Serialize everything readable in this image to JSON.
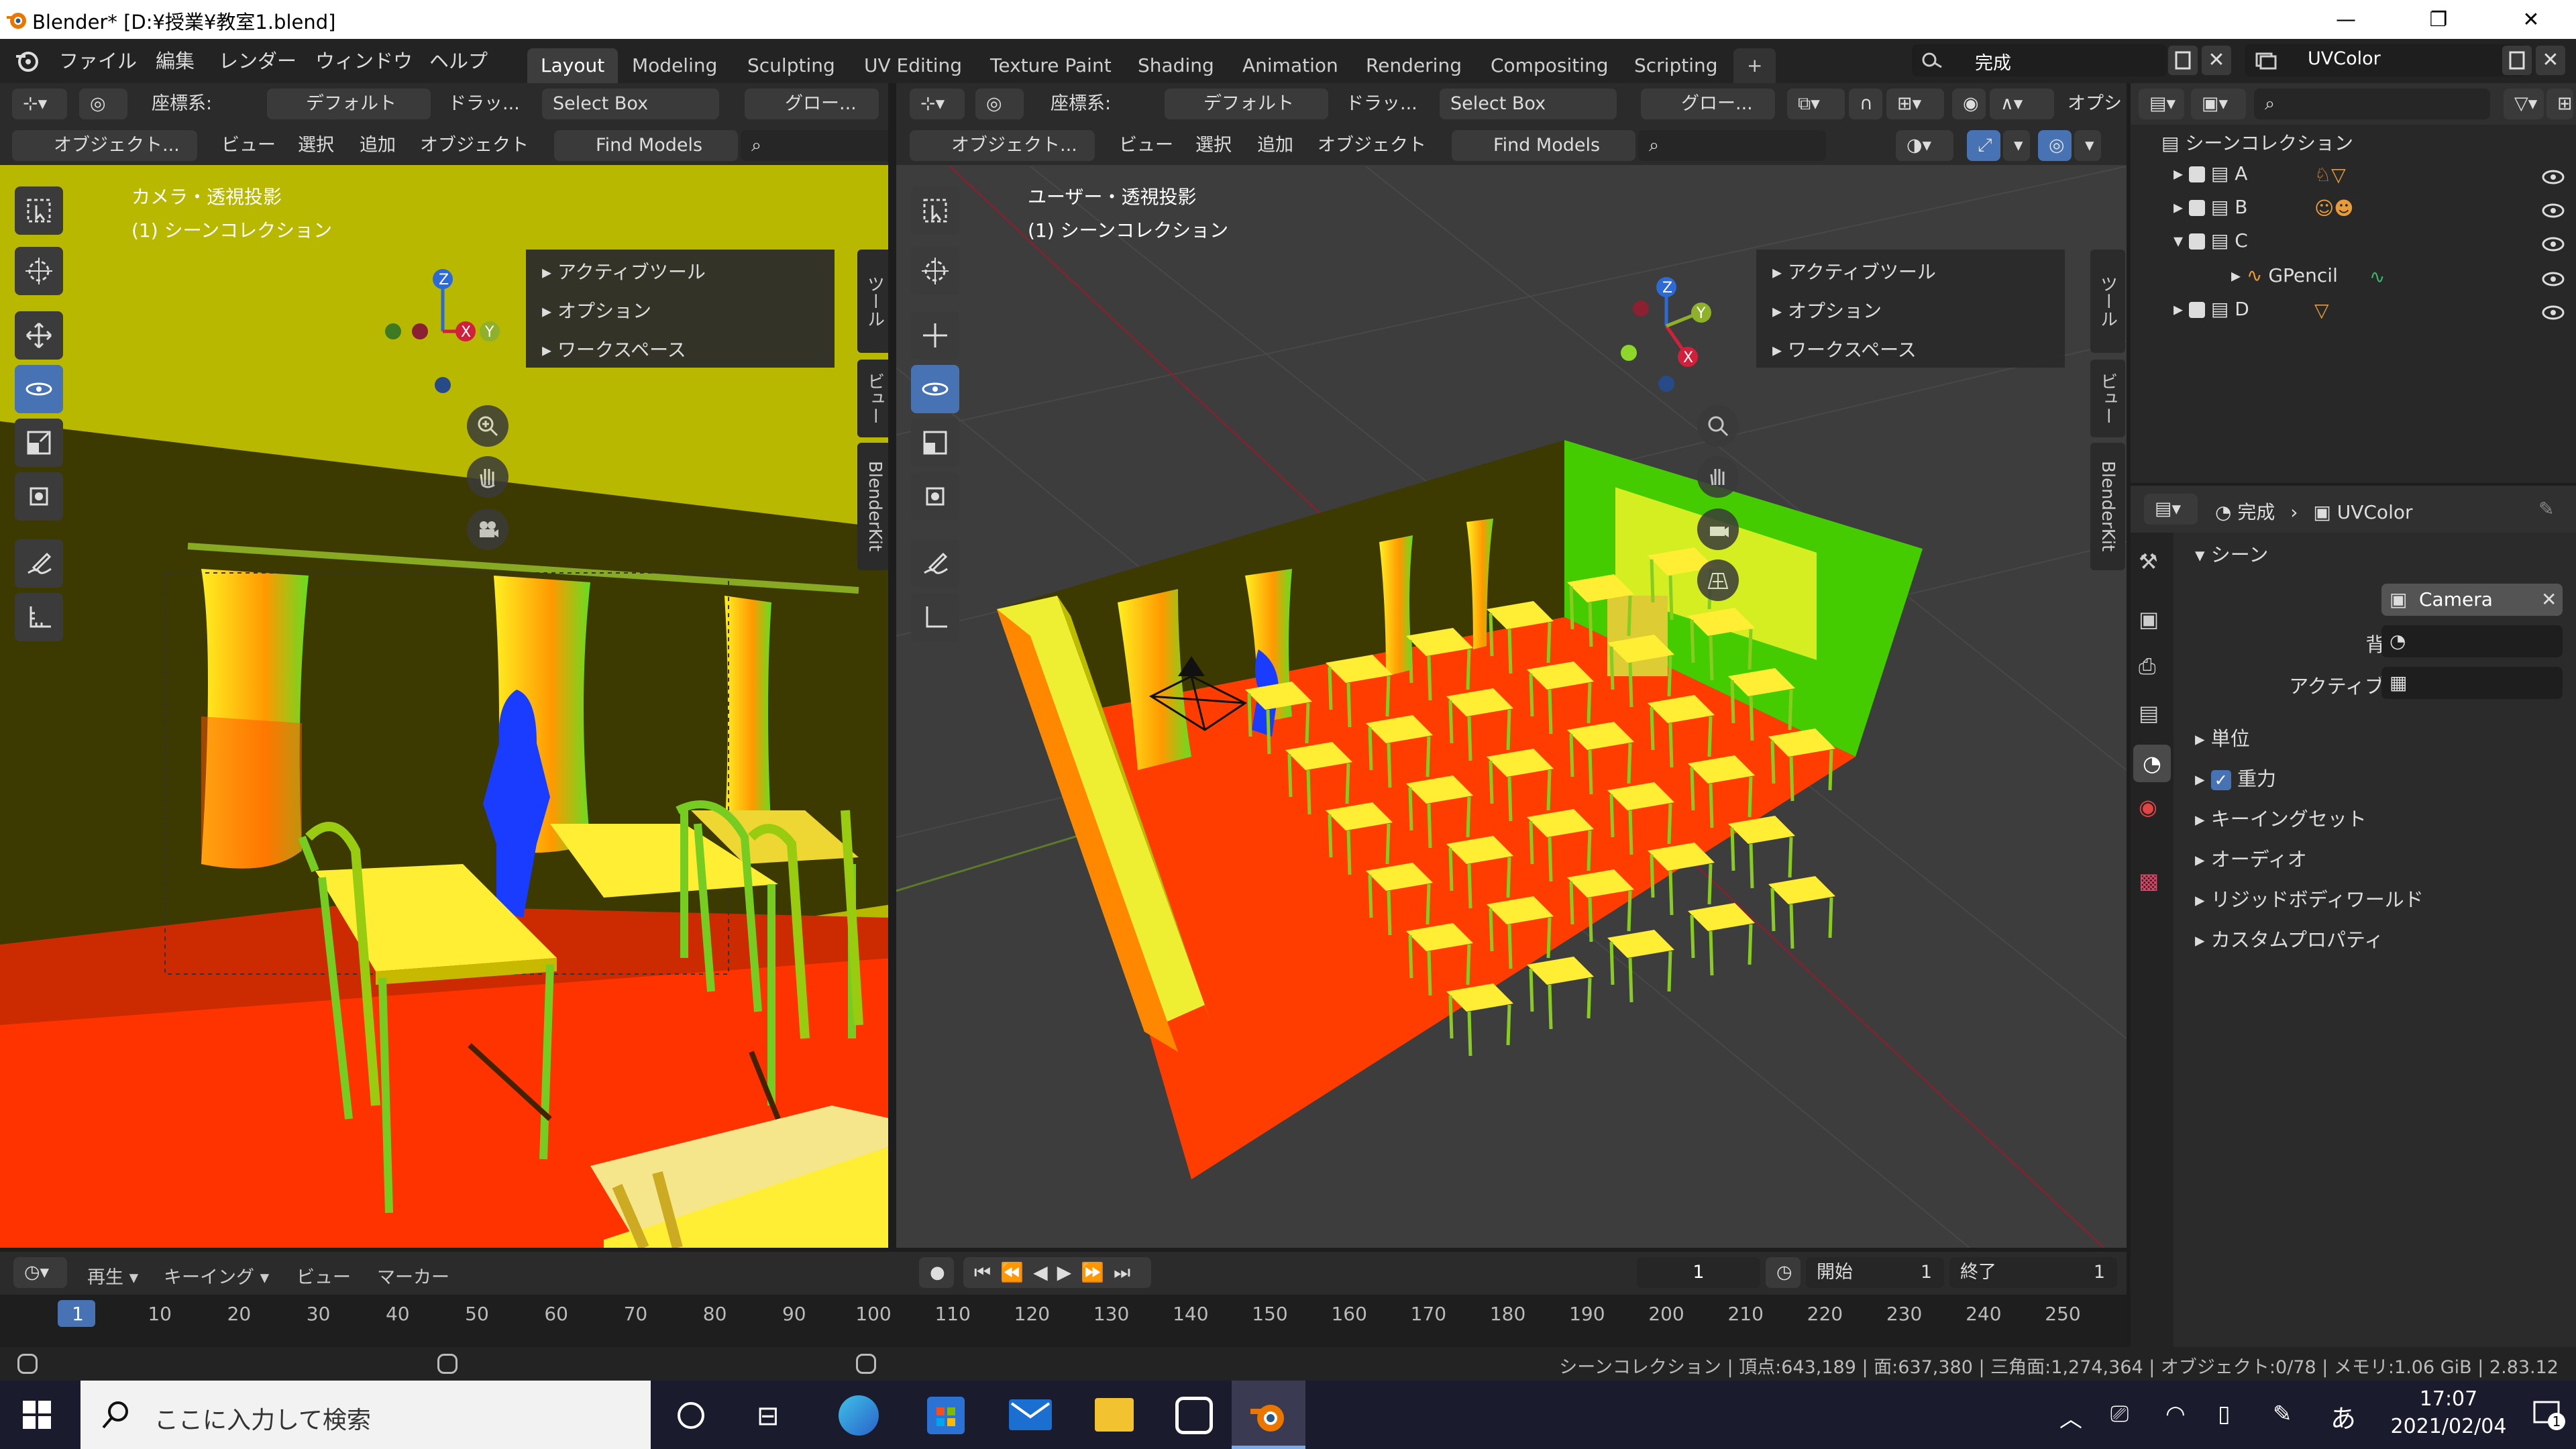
{
  "window": {
    "title": "Blender* [D:¥授業¥教室1.blend]",
    "min": "—",
    "max": "❐",
    "close": "✕"
  },
  "menu": [
    "ファイル",
    "編集",
    "レンダー",
    "ウィンドウ",
    "ヘルプ"
  ],
  "workspaces": [
    "Layout",
    "Modeling",
    "Sculpting",
    "UV Editing",
    "Texture Paint",
    "Shading",
    "Animation",
    "Rendering",
    "Compositing",
    "Scripting",
    "+"
  ],
  "scene_selector": {
    "scene": "完成",
    "view_layer": "UVColor"
  },
  "left_viewport": {
    "coord_label": "座標系:",
    "orientation": "デフォルト",
    "drag_label": "ドラッ...",
    "select_mode": "Select Box",
    "pivot": "グロー...",
    "mode": "オブジェクト...",
    "view": "ビュー",
    "select": "選択",
    "add": "追加",
    "object": "オブジェクト",
    "find_models": "Find Models",
    "overlay_line1": "カメラ・透視投影",
    "overlay_line2": "(1) シーンコレクション",
    "panel_items": [
      "アクティブツール",
      "オプション",
      "ワークスペース"
    ],
    "side_tabs": [
      "ツール",
      "ビュー",
      "BlenderKit"
    ]
  },
  "right_viewport": {
    "coord_label": "座標系:",
    "orientation": "デフォルト",
    "drag_label": "ドラッ...",
    "select_mode": "Select Box",
    "pivot": "グロー...",
    "options": "オプシ",
    "mode": "オブジェクト...",
    "view": "ビュー",
    "select": "選択",
    "add": "追加",
    "object": "オブジェクト",
    "find_models": "Find Models",
    "overlay_line1": "ユーザー・透視投影",
    "overlay_line2": "(1) シーンコレクション",
    "panel_items": [
      "アクティブツール",
      "オプション",
      "ワークスペース"
    ],
    "side_tabs": [
      "ツール",
      "ビュー",
      "BlenderKit"
    ]
  },
  "gizmo_axes": {
    "x": "X",
    "y": "Y",
    "z": "Z"
  },
  "outliner": {
    "root": "シーンコレクション",
    "items": [
      {
        "name": "A",
        "expanded": false
      },
      {
        "name": "B",
        "expanded": false
      },
      {
        "name": "C",
        "expanded": true
      },
      {
        "name": "GPencil",
        "child": true
      },
      {
        "name": "D",
        "expanded": false
      }
    ]
  },
  "properties": {
    "breadcrumb_scene": "完成",
    "breadcrumb_sep": "›",
    "breadcrumb_layer": "UVColor",
    "section": "シーン",
    "camera_label": "カメラ",
    "camera_value": "Camera",
    "bg_scene_label": "背景シーン",
    "active_clip_label": "アクティブクリップ",
    "subsections": [
      "単位",
      "重力",
      "キーイングセット",
      "オーディオ",
      "リジッドボディワールド",
      "カスタムプロパティ"
    ]
  },
  "timeline": {
    "playback": "再生",
    "keying": "キーイング",
    "view": "ビュー",
    "marker": "マーカー",
    "current_frame": "1",
    "start_label": "開始",
    "start": "1",
    "end_label": "終了",
    "end": "1",
    "ticks": [
      "1",
      "10",
      "20",
      "30",
      "40",
      "50",
      "60",
      "70",
      "80",
      "90",
      "100",
      "110",
      "120",
      "130",
      "140",
      "150",
      "160",
      "170",
      "180",
      "190",
      "200",
      "210",
      "220",
      "230",
      "240",
      "250"
    ]
  },
  "statusbar": "シーンコレクション | 頂点:643,189 | 面:637,380 | 三角面:1,274,364 | オブジェクト:0/78 | メモリ:1.06 GiB | 2.83.12",
  "taskbar": {
    "search_placeholder": "ここに入力して検索",
    "ime": "あ",
    "time": "17:07",
    "date": "2021/02/04",
    "notif": "1"
  },
  "colors": {
    "accent": "#4772b3",
    "floor": "#ff3d00",
    "wall_left": "#b8b800",
    "desk": "#ffee33",
    "figure": "#1a3cff"
  }
}
